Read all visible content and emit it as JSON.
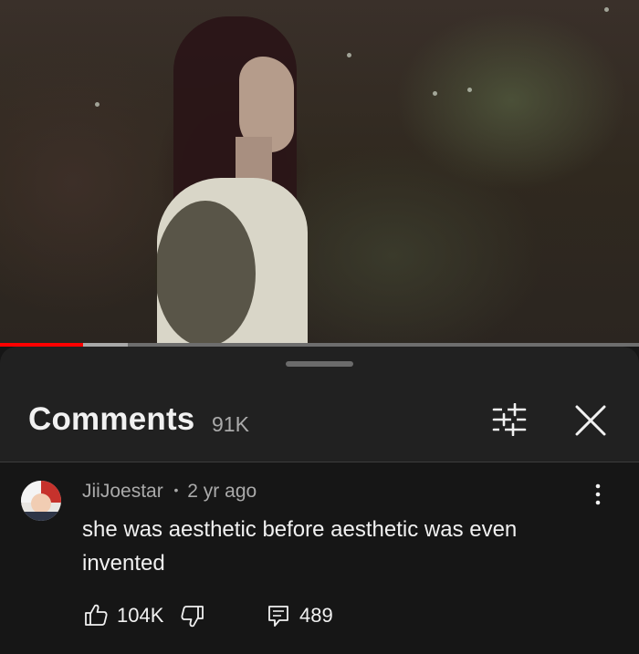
{
  "player": {
    "progress_fraction": 0.13,
    "buffered_fraction": 0.2,
    "played_color": "#ff0000"
  },
  "comments_panel": {
    "title": "Comments",
    "count": "91K",
    "filter_icon": "sort-filter-icon",
    "close_icon": "close-icon"
  },
  "comment": {
    "author": "JiiJoestar",
    "separator": "•",
    "age": "2 yr ago",
    "text": "she was aesthetic before aesthetic was even invented",
    "likes": "104K",
    "replies": "489",
    "icons": [
      "avatar",
      "more-vert-icon",
      "thumb-up-icon",
      "thumb-down-icon",
      "reply-icon"
    ]
  }
}
